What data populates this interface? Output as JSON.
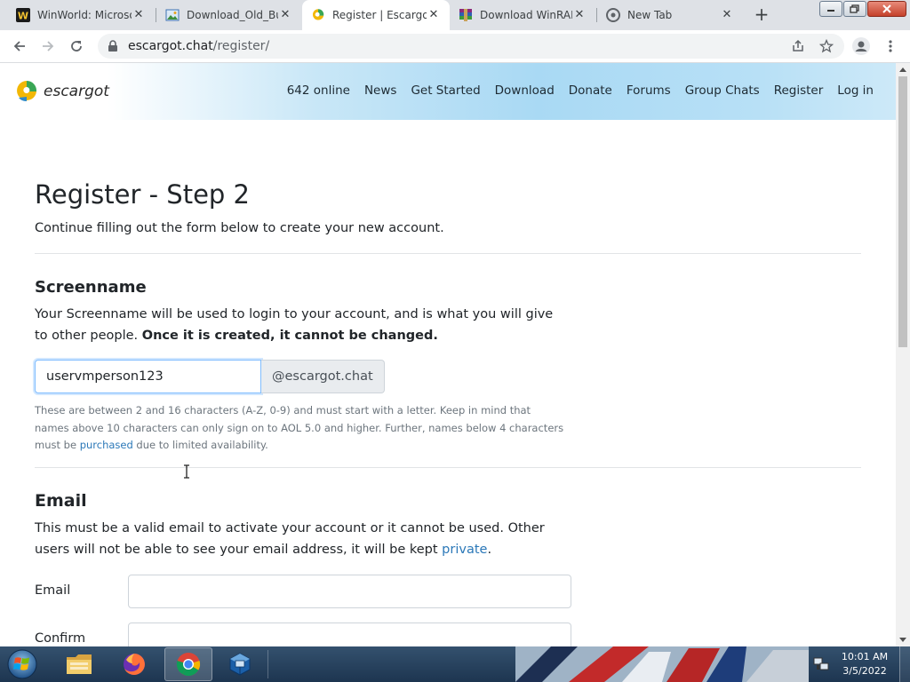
{
  "browser": {
    "tabs": [
      {
        "title": "WinWorld: Microso",
        "favicon": "winworld-w-icon",
        "active": false
      },
      {
        "title": "Download_Old_Bu",
        "favicon": "image-file-icon",
        "active": false
      },
      {
        "title": "Register | Escargot",
        "favicon": "escargot-icon",
        "active": true
      },
      {
        "title": "Download WinRAR",
        "favicon": "winrar-icon",
        "active": false
      },
      {
        "title": "New Tab",
        "favicon": "chrome-icon",
        "active": false
      }
    ],
    "address": {
      "host": "escargot.chat",
      "path": "/register/"
    }
  },
  "site": {
    "logo_text": "escargot",
    "nav": [
      "642 online",
      "News",
      "Get Started",
      "Download",
      "Donate",
      "Forums",
      "Group Chats",
      "Register",
      "Log in"
    ]
  },
  "page": {
    "title": "Register - Step 2",
    "subtitle": "Continue filling out the form below to create your new account.",
    "screenname": {
      "heading": "Screenname",
      "desc": "Your Screenname will be used to login to your account, and is what you will give to other people. ",
      "desc_bold": "Once it is created, it cannot be changed.",
      "value": "uservmperson123",
      "suffix": "@escargot.chat",
      "help_before": "These are between 2 and 16 characters (A-Z, 0-9) and must start with a letter. Keep in mind that names above 10 characters can only sign on to AOL 5.0 and higher. Further, names below 4 characters must be ",
      "help_link": "purchased",
      "help_after": " due to limited availability."
    },
    "email": {
      "heading": "Email",
      "desc": "This must be a valid email to activate your account or it cannot be used. Other users will not be able to see your email address, it will be kept ",
      "desc_link": "private",
      "desc_end": ".",
      "email_label": "Email",
      "email_value": "",
      "confirm_label": "Confirm",
      "confirm_value": ""
    }
  },
  "taskbar": {
    "apps": [
      "windows-explorer",
      "firefox",
      "chrome",
      "virtualbox"
    ],
    "active_app": "chrome",
    "clock_time": "10:01 AM",
    "clock_date": "3/5/2022"
  },
  "colors": {
    "link": "#2b78b8",
    "header_gradient_end": "#a9d9f4",
    "text": "#212529"
  }
}
